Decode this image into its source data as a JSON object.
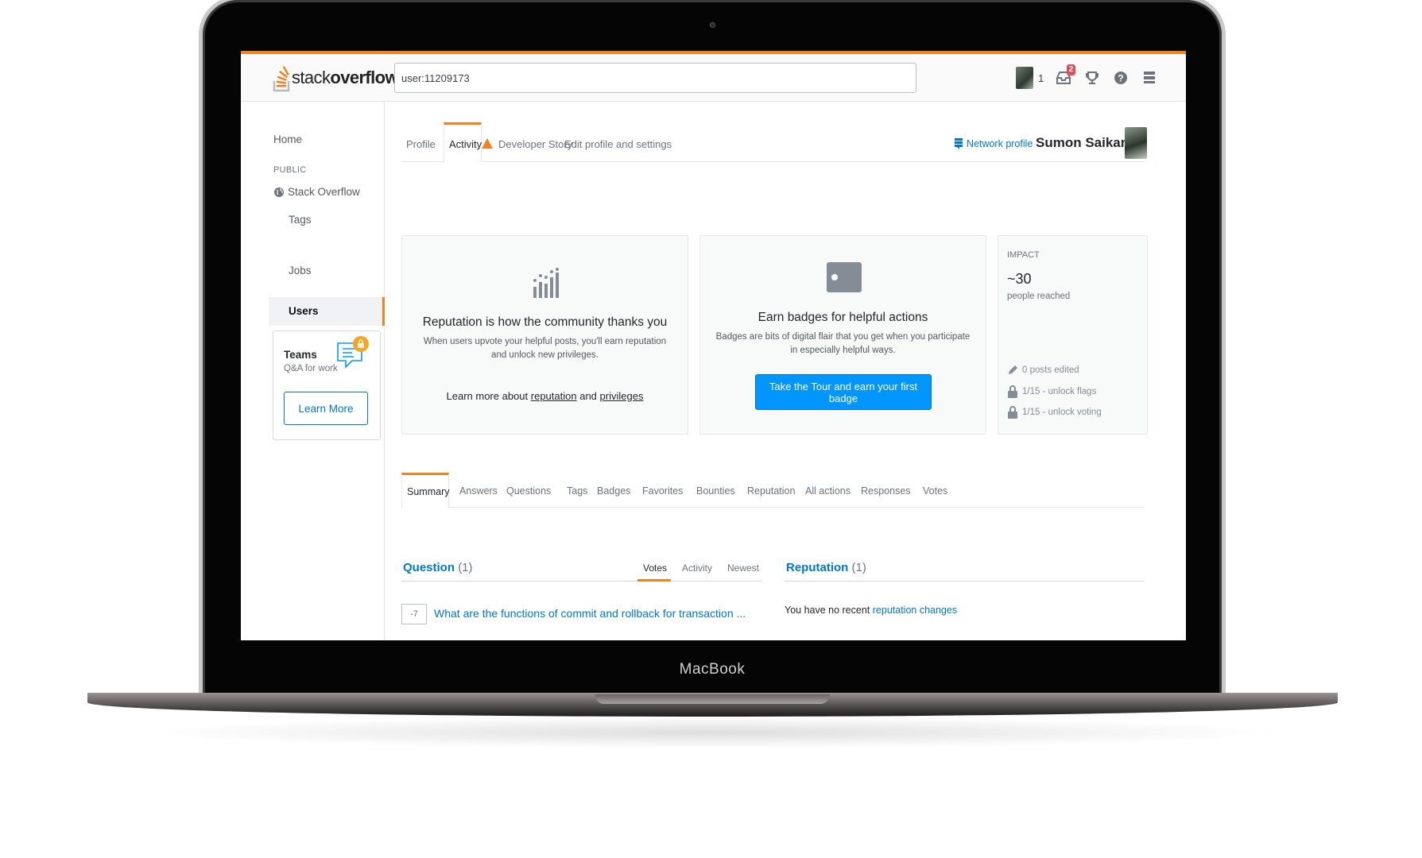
{
  "device": {
    "label": "MacBook"
  },
  "header": {
    "logo": {
      "thin": "stack",
      "bold": "overflow"
    },
    "search_value": "user:11209173",
    "reputation": "1",
    "inbox_badge": "2",
    "colors": {
      "accent": "#f48024",
      "link": "#0077cc",
      "button": "#0095ff",
      "badge": "#de4f54"
    }
  },
  "sidebar": {
    "home": "Home",
    "public_label": "PUBLIC",
    "stack_overflow": "Stack Overflow",
    "tags": "Tags",
    "users": "Users",
    "jobs": "Jobs",
    "teams": {
      "title": "Teams",
      "subtitle": "Q&A for work",
      "button": "Learn More"
    }
  },
  "profile_tabs": {
    "profile": "Profile",
    "activity": "Activity",
    "developer_story": "Developer Story",
    "edit": "Edit profile and settings",
    "network_profile": "Network profile",
    "user_name": "Sumon Saikan"
  },
  "cards": {
    "reputation": {
      "title": "Reputation is how the community thanks you",
      "text": "When users upvote your helpful posts, you'll earn reputation and unlock new privileges.",
      "learn_prefix": "Learn more about",
      "learn_link1": "reputation",
      "learn_and": "and",
      "learn_link2": "privileges"
    },
    "badges": {
      "title": "Earn badges for helpful actions",
      "text": "Badges are bits of digital flair that you get when you participate in especially helpful ways.",
      "button": "Take the Tour and earn your first badge"
    },
    "impact": {
      "label": "IMPACT",
      "value": "~30",
      "sub": "people reached",
      "posts_edited": "0 posts edited",
      "unlock_flags": "1/15 - unlock flags",
      "unlock_voting": "1/15 - unlock voting"
    }
  },
  "activity_tabs": [
    "Summary",
    "Answers",
    "Questions",
    "Tags",
    "Badges",
    "Favorites",
    "Bounties",
    "Reputation",
    "All actions",
    "Responses",
    "Votes"
  ],
  "questions": {
    "title": "Question",
    "count": "(1)",
    "sort": {
      "votes": "Votes",
      "activity": "Activity",
      "newest": "Newest"
    },
    "items": [
      {
        "score": "-7",
        "title": "What are the functions of commit and rollback for transaction ..."
      }
    ]
  },
  "reputation_panel": {
    "title": "Reputation",
    "count": "(1)",
    "message": "You have no recent",
    "link": "reputation changes"
  }
}
